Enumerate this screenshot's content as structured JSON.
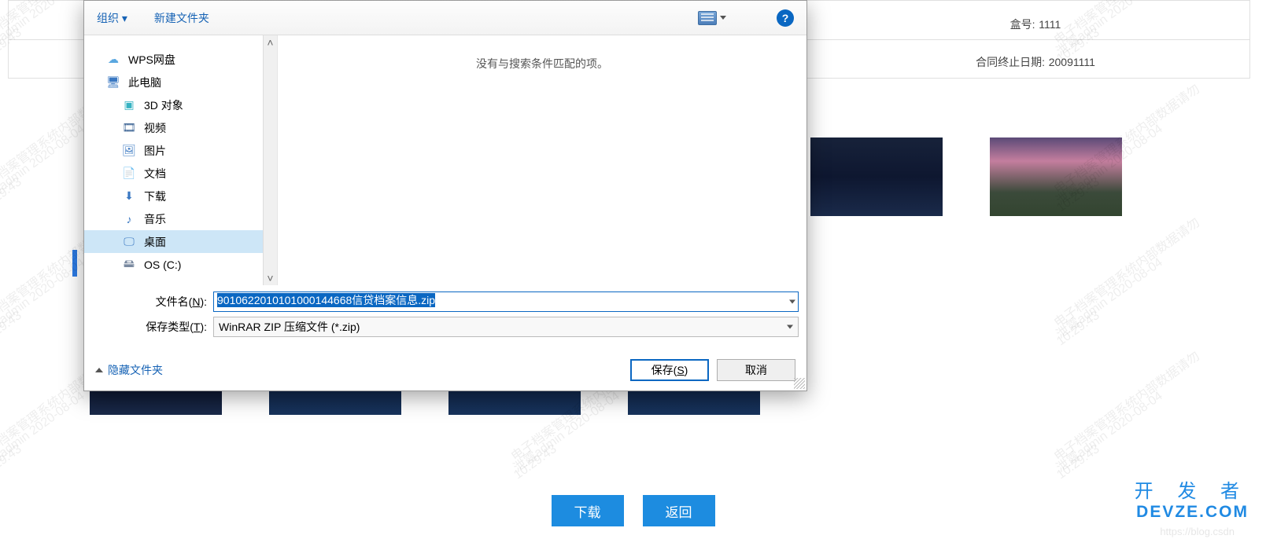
{
  "page": {
    "info_box_label": "盒号:",
    "info_box_value": "1111",
    "info_enddate_label": "合同终止日期:",
    "info_enddate_value": "20091111",
    "download_btn": "下载",
    "back_btn": "返回",
    "brand_zh": "开 发 者",
    "brand_en": "DEVZE.COM",
    "blog_mark": "https://blog.csdn"
  },
  "watermark": {
    "line1": "电子档案管理系统内部数据请勿",
    "line2": "泄露admin 2020-08-04",
    "line3": "10:29:43"
  },
  "dialog": {
    "organize": "组织 ▾",
    "new_folder": "新建文件夹",
    "help_glyph": "?",
    "empty_msg": "没有与搜索条件匹配的项。",
    "sidebar": [
      {
        "icon": "cloud",
        "label": "WPS网盘",
        "nested": false
      },
      {
        "icon": "pc",
        "label": "此电脑",
        "nested": false
      },
      {
        "icon": "cube",
        "label": "3D 对象",
        "nested": true
      },
      {
        "icon": "film",
        "label": "视频",
        "nested": true
      },
      {
        "icon": "image",
        "label": "图片",
        "nested": true
      },
      {
        "icon": "doc",
        "label": "文档",
        "nested": true
      },
      {
        "icon": "download",
        "label": "下载",
        "nested": true
      },
      {
        "icon": "music",
        "label": "音乐",
        "nested": true
      },
      {
        "icon": "desktop",
        "label": "桌面",
        "nested": true,
        "selected": true
      },
      {
        "icon": "drive",
        "label": "OS (C:)",
        "nested": true
      }
    ],
    "filename_label_pre": "文件名(",
    "filename_label_u": "N",
    "filename_label_post": "):",
    "filename_value": "9010622010101000144668信贷档案信息.zip",
    "savetype_label_pre": "保存类型(",
    "savetype_label_u": "T",
    "savetype_label_post": "):",
    "savetype_value": "WinRAR ZIP 压缩文件 (*.zip)",
    "hide_folders": "隐藏文件夹",
    "save_btn_pre": "保存(",
    "save_btn_u": "S",
    "save_btn_post": ")",
    "cancel_btn": "取消"
  },
  "icons": {
    "cloud": "☁",
    "pc": "🖥",
    "cube": "▣",
    "film": "🎞",
    "image": "🖼",
    "doc": "📄",
    "download": "⬇",
    "music": "♪",
    "desktop": "🖵",
    "drive": "🖴"
  }
}
